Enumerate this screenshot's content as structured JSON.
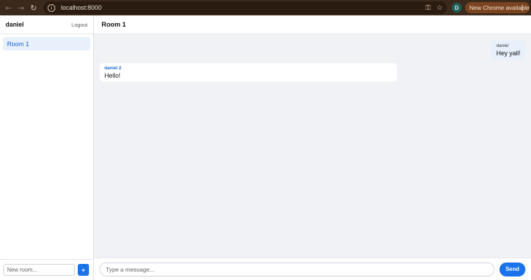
{
  "browser": {
    "url": "localhost:8000",
    "profile_initial": "D",
    "update_label": "New Chrome available",
    "icons": [
      "back-arrow-icon",
      "forward-arrow-icon",
      "reload-icon",
      "site-info-icon",
      "password-key-icon",
      "bookmark-star-icon",
      "more-vert-icon"
    ]
  },
  "sidebar": {
    "username": "daniel",
    "logout_label": "Logout",
    "rooms": [
      {
        "label": "Room 1",
        "active": true
      }
    ],
    "new_room_placeholder": "New room...",
    "add_room_label": "+"
  },
  "main": {
    "room_title": "Room 1",
    "messages": [
      {
        "sender": "daniel",
        "text": "Hey yall!",
        "own": true
      },
      {
        "sender": "daniel 2",
        "text": "Hello!",
        "own": false
      }
    ],
    "message_placeholder": "Type a message...",
    "send_label": "Send"
  },
  "colors": {
    "accent": "#1a73e8",
    "own_bubble": "#e8f0fc",
    "chat_background": "#f0f2f5",
    "browser_frame": "#3b2a1c"
  }
}
